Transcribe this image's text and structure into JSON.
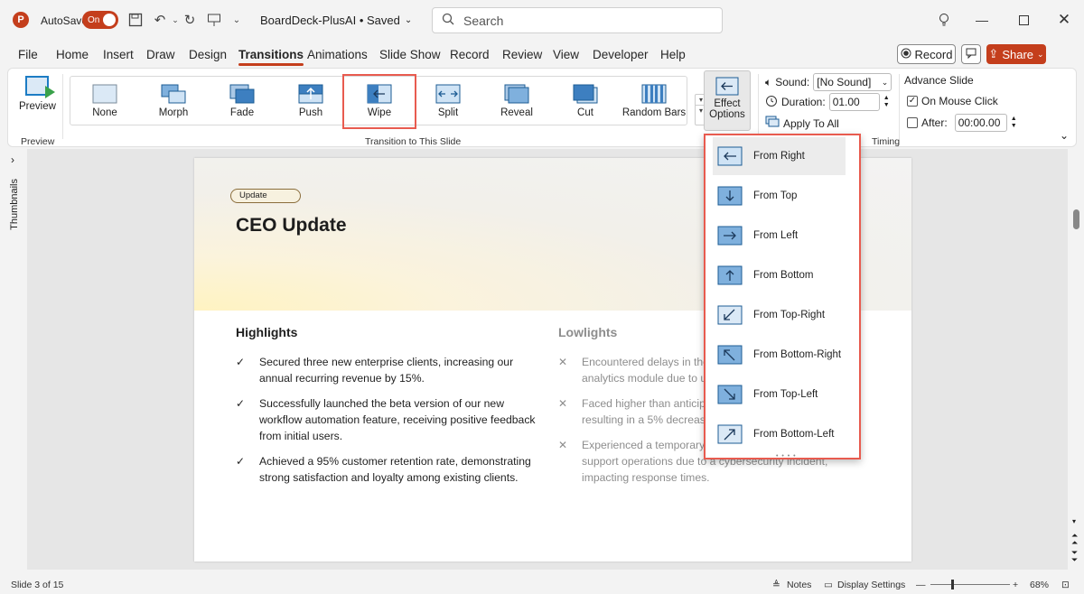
{
  "titlebar": {
    "app_logo": "P",
    "autosave_label": "AutoSave",
    "autosave_state": "On",
    "doc_title": "BoardDeck-PlusAI • Saved",
    "search_placeholder": "Search"
  },
  "menu": [
    "File",
    "Home",
    "Insert",
    "Draw",
    "Design",
    "Transitions",
    "Animations",
    "Slide Show",
    "Record",
    "Review",
    "View",
    "Developer",
    "Help"
  ],
  "menu_active": "Transitions",
  "actions": {
    "record": "Record",
    "share": "Share"
  },
  "ribbon": {
    "preview_label": "Preview",
    "preview_group": "Preview",
    "gallery_group": "Transition to This Slide",
    "timing_group": "Timing",
    "transitions": [
      "None",
      "Morph",
      "Fade",
      "Push",
      "Wipe",
      "Split",
      "Reveal",
      "Cut",
      "Random Bars"
    ],
    "selected_transition": "Wipe",
    "effect_options_line1": "Effect",
    "effect_options_line2": "Options",
    "sound_label": "Sound:",
    "sound_value": "[No Sound]",
    "duration_label": "Duration:",
    "duration_value": "01.00",
    "apply_all": "Apply To All",
    "advance_title": "Advance Slide",
    "on_mouse_click": "On Mouse Click",
    "on_mouse_click_checked": true,
    "after_label": "After:",
    "after_value": "00:00.00",
    "after_checked": false
  },
  "effect_options": [
    "From Right",
    "From Top",
    "From Left",
    "From Bottom",
    "From Top-Right",
    "From Bottom-Right",
    "From Top-Left",
    "From Bottom-Left"
  ],
  "effect_selected": "From Right",
  "sidebar": {
    "thumbnails_label": "Thumbnails"
  },
  "slide": {
    "badge": "Update",
    "title": "CEO Update",
    "highlights_title": "Highlights",
    "highlights": [
      [
        "Secured three new enterprise clients, increasing our",
        "annual recurring revenue by 15%."
      ],
      [
        "Successfully launched the beta version of our new",
        "workflow automation feature, receiving positive feedback",
        "from initial users."
      ],
      [
        "Achieved a 95% customer retention rate, demonstrating",
        "strong satisfaction and loyalty among existing clients."
      ]
    ],
    "lowlights_title": "Lowlights",
    "lowlights": [
      [
        "Encountered delays in the",
        "analytics module due to ur"
      ],
      [
        "Faced higher than anticipa",
        "resulting in a 5% decrease"
      ],
      [
        "Experienced a temporary c",
        "support operations due to a cybersecurity incident,",
        "impacting response times."
      ]
    ]
  },
  "status": {
    "slide_info": "Slide 3 of 15",
    "notes": "Notes",
    "display_settings": "Display Settings",
    "zoom": "68%"
  },
  "colors": {
    "accent": "#c43e1c",
    "highlight_outline": "#e85b4f",
    "icon_blue": "#1c7cc4"
  }
}
